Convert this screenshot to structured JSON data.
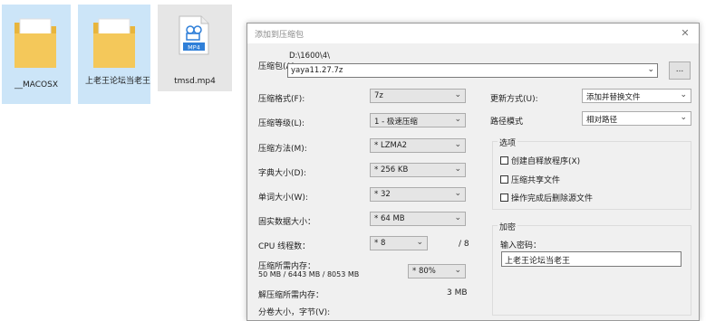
{
  "desktop": {
    "files": [
      {
        "name": "__MACOSX"
      },
      {
        "name": "上老王论坛当老王"
      },
      {
        "name": "tmsd.mp4",
        "badge": "MP4"
      }
    ]
  },
  "dialog": {
    "title": "添加到压缩包",
    "close": "✕",
    "archive_label": "压缩包(A)",
    "archive_path": "D:\\1600\\4\\",
    "archive_name": "yaya11.27.7z",
    "browse": "...",
    "format_label": "压缩格式(F):",
    "format_value": "7z",
    "level_label": "压缩等级(L):",
    "level_value": "1 - 极速压缩",
    "method_label": "压缩方法(M):",
    "method_value": "* LZMA2",
    "dict_label": "字典大小(D):",
    "dict_value": "* 256 KB",
    "word_label": "单词大小(W):",
    "word_value": "* 32",
    "solid_label": "固实数据大小：",
    "solid_value": "* 64 MB",
    "cpu_label": "CPU 线程数：",
    "cpu_value": "* 8",
    "cpu_max": "/ 8",
    "mem_label": "压缩所需内存：",
    "mem_detail": "50 MB / 6443 MB / 8053 MB",
    "mem_value": "* 80%",
    "decomp_label": "解压缩所需内存：",
    "decomp_value": "3 MB",
    "split_label": "分卷大小，字节(V):",
    "update_label": "更新方式(U):",
    "update_value": "添加并替换文件",
    "pathmode_label": "路径模式",
    "pathmode_value": "相对路径",
    "options_title": "选项",
    "opt_sfx": "创建自释放程序(X)",
    "opt_shared": "压缩共享文件",
    "opt_delete": "操作完成后删除源文件",
    "encrypt_title": "加密",
    "password_label": "输入密码：",
    "password_value": "上老王论坛当老王"
  },
  "colors": {
    "selection": "#cce5f8",
    "folder": "#f0c04a",
    "video_badge": "#2f7fd8"
  },
  "icons": [
    "folder-icon",
    "folder-icon",
    "video-file-icon",
    "chevron-down-icon",
    "close-icon",
    "checkbox-icon"
  ]
}
